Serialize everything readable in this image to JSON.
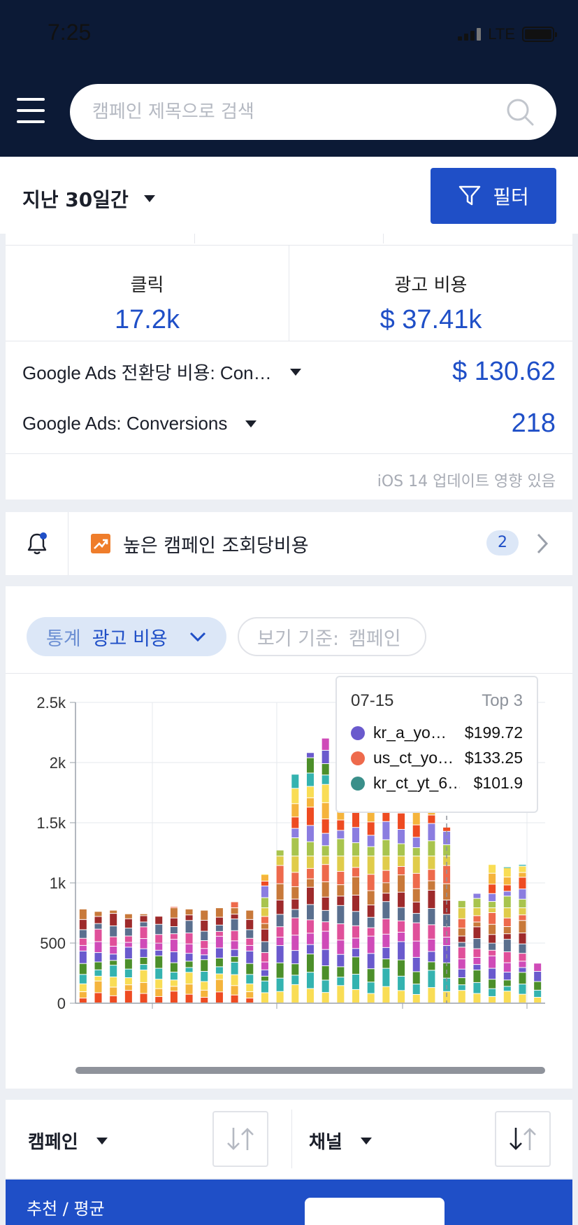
{
  "status": {
    "time": "7:25",
    "network": "LTE"
  },
  "search": {
    "placeholder": "캠페인 제목으로 검색"
  },
  "filter_bar": {
    "period_label": "지난 30일간",
    "filter_button": "필터"
  },
  "metrics": {
    "clicks_label": "클릭",
    "clicks_value": "17.2k",
    "spend_label": "광고 비용",
    "spend_value": "$ 37.41k",
    "kpis": [
      {
        "label": "Google Ads 전환당 비용: Con…",
        "value": "$ 130.62"
      },
      {
        "label": "Google Ads: Conversions",
        "value": "218"
      }
    ],
    "note": "iOS 14 업데이트 영향 있음"
  },
  "alert": {
    "text": "높은 캠페인 조회당비용",
    "count": "2"
  },
  "chart_controls": {
    "stat_key": "통계",
    "stat_value": "광고 비용",
    "view_key": "보기 기준:",
    "view_value": "캠페인"
  },
  "tooltip": {
    "date": "07-15",
    "top_label": "Top 3",
    "rows": [
      {
        "name": "kr_a_yo…",
        "value": "$199.72",
        "color": "#6a5acd"
      },
      {
        "name": "us_ct_yo…",
        "value": "$133.25",
        "color": "#ee6a4c"
      },
      {
        "name": "kr_ct_yt_6…",
        "value": "$101.9",
        "color": "#3a8f8a"
      }
    ]
  },
  "chart_data": {
    "type": "bar",
    "stacked": true,
    "ylim": [
      0,
      2500
    ],
    "yticks": [
      "0",
      "500",
      "1k",
      "1.5k",
      "2k",
      "2.5k"
    ],
    "series_colors": [
      "#ee4b22",
      "#f5b43c",
      "#f9dd55",
      "#34b3b0",
      "#4c8f2a",
      "#6a5acd",
      "#cf4bb8",
      "#e0509a",
      "#5a6f8e",
      "#9e2a2b",
      "#c8793a",
      "#ee6a4c",
      "#e0cc4a",
      "#a8c44e",
      "#8b7de0"
    ],
    "totals": [
      780,
      760,
      770,
      740,
      740,
      720,
      800,
      780,
      770,
      790,
      840,
      770,
      1070,
      1270,
      1900,
      2080,
      2200,
      2230,
      2140,
      2130,
      2100,
      2180,
      2160,
      1760,
      1460,
      850,
      910,
      1150,
      1130,
      1150,
      330
    ],
    "grid": true
  },
  "table_header": {
    "col1": "캠페인",
    "col2": "채널"
  },
  "bottom": {
    "label": "추천 / 평균"
  }
}
